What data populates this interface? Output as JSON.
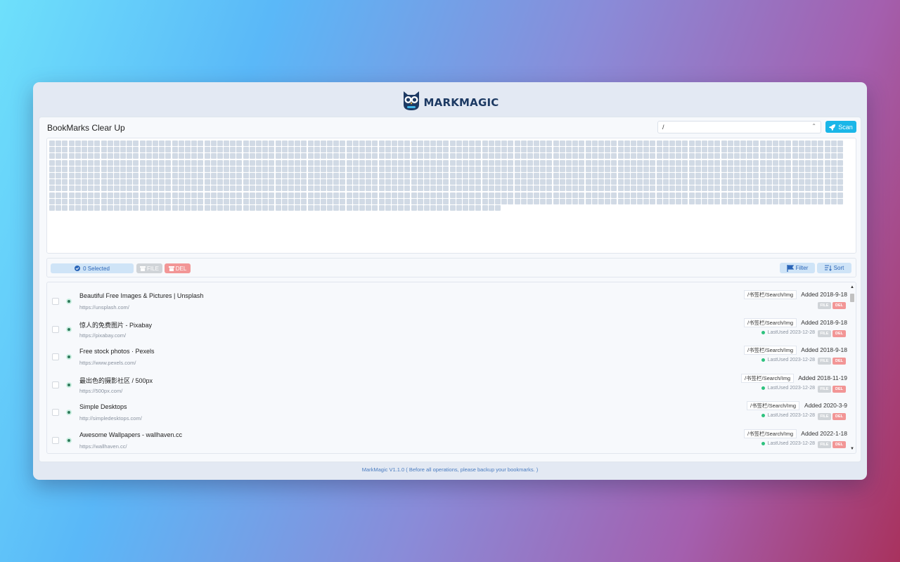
{
  "app": {
    "logo_text": "MARKMAGIC",
    "title": "BookMarks Clear Up",
    "footer": "MarkMagic V1.1.0 ( Before all operations, please backup your bookmarks. )"
  },
  "toolbar_top": {
    "path_value": "/",
    "scan_label": "Scan",
    "accent_color": "#1ab6e8"
  },
  "grid": {
    "cell_count": 1300
  },
  "toolbar": {
    "selected_label": "0 Selected",
    "file_label": "FILE",
    "del_label": "DEL",
    "filter_label": "Filter",
    "sort_label": "Sort"
  },
  "bookmarks": [
    {
      "title": "Beautiful Free Images & Pictures | Unsplash",
      "url": "https://unsplash.com/",
      "path": "/书签栏/Search/Img",
      "added": "Added 2018-9-18",
      "last_used": "",
      "file": "FILE",
      "del": "DEL"
    },
    {
      "title": "惊人的免费图片 - Pixabay",
      "url": "https://pixabay.com/",
      "path": "/书签栏/Search/Img",
      "added": "Added 2018-9-18",
      "last_used": "LastUsed 2023-12-28",
      "file": "FILE",
      "del": "DEL"
    },
    {
      "title": "Free stock photos · Pexels",
      "url": "https://www.pexels.com/",
      "path": "/书签栏/Search/Img",
      "added": "Added 2018-9-18",
      "last_used": "LastUsed 2023-12-28",
      "file": "FILE",
      "del": "DEL"
    },
    {
      "title": "最出色的摄影社区 / 500px",
      "url": "https://500px.com/",
      "path": "/书签栏/Search/Img",
      "added": "Added 2018-11-19",
      "last_used": "LastUsed 2023-12-28",
      "file": "FILE",
      "del": "DEL"
    },
    {
      "title": "Simple Desktops",
      "url": "http://simpledesktops.com/",
      "path": "/书签栏/Search/Img",
      "added": "Added 2020-3-9",
      "last_used": "LastUsed 2023-12-28",
      "file": "FILE",
      "del": "DEL"
    },
    {
      "title": "Awesome Wallpapers - wallhaven.cc",
      "url": "https://wallhaven.cc/",
      "path": "/书签栏/Search/Img",
      "added": "Added 2022-1-18",
      "last_used": "LastUsed 2023-12-28",
      "file": "FILE",
      "del": "DEL"
    }
  ]
}
